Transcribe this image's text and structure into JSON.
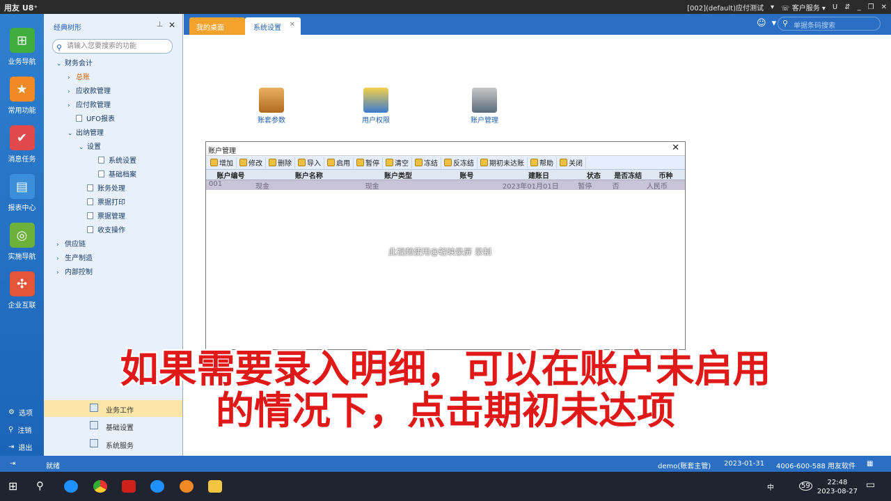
{
  "titlebar": {
    "app_name": "用友 U8⁺",
    "account": "[002](default)应付测试",
    "customer_service": "客户服务",
    "controls": [
      "U",
      "⇵",
      "_",
      "❐",
      "✕"
    ]
  },
  "nav": [
    {
      "label": "业务导航",
      "icon": "tree-icon",
      "color": "#3fae3f"
    },
    {
      "label": "常用功能",
      "icon": "star-icon",
      "color": "#f08a24"
    },
    {
      "label": "消息任务",
      "icon": "check-icon",
      "color": "#e04a4a"
    },
    {
      "label": "报表中心",
      "icon": "chart-icon",
      "color": "#3a8fd8"
    },
    {
      "label": "实施导航",
      "icon": "compass-icon",
      "color": "#6bb13a"
    },
    {
      "label": "企业互联",
      "icon": "link-icon",
      "color": "#e45438"
    }
  ],
  "bottom_nav": [
    {
      "label": "选项",
      "icon": "⚙"
    },
    {
      "label": "注销",
      "icon": "⚲"
    },
    {
      "label": "退出",
      "icon": "⇥"
    }
  ],
  "tree": {
    "title": "经典树形",
    "search_placeholder": "请输入您要搜索的功能",
    "nodes": [
      {
        "label": "财务会计",
        "arrow": "⌄",
        "indent": 0
      },
      {
        "label": "总账",
        "arrow": "›",
        "indent": 1,
        "active": true
      },
      {
        "label": "应收款管理",
        "arrow": "›",
        "indent": 1
      },
      {
        "label": "应付款管理",
        "arrow": "›",
        "indent": 1
      },
      {
        "label": "UFO报表",
        "arrow": "",
        "indent": 1,
        "doc": true
      },
      {
        "label": "出纳管理",
        "arrow": "⌄",
        "indent": 1
      },
      {
        "label": "设置",
        "arrow": "⌄",
        "indent": 2
      },
      {
        "label": "系统设置",
        "arrow": "",
        "indent": 3,
        "doc": true
      },
      {
        "label": "基础档案",
        "arrow": "",
        "indent": 3,
        "doc": true
      },
      {
        "label": "账务处理",
        "arrow": "",
        "indent": 2,
        "doc": true
      },
      {
        "label": "票据打印",
        "arrow": "",
        "indent": 2,
        "doc": true
      },
      {
        "label": "票据管理",
        "arrow": "",
        "indent": 2,
        "doc": true
      },
      {
        "label": "收支操作",
        "arrow": "",
        "indent": 2,
        "doc": true
      },
      {
        "label": "供应链",
        "arrow": "›",
        "indent": 0
      },
      {
        "label": "生产制造",
        "arrow": "›",
        "indent": 0
      },
      {
        "label": "内部控制",
        "arrow": "›",
        "indent": 0
      }
    ],
    "bottom_items": [
      "业务工作",
      "基础设置",
      "系统服务"
    ]
  },
  "tabs": {
    "desktop": "我的桌面",
    "settings": "系统设置",
    "search_placeholder": "单据条码搜索"
  },
  "shortcuts": [
    {
      "label": "账套参数"
    },
    {
      "label": "用户权限"
    },
    {
      "label": "账户管理"
    }
  ],
  "dialog": {
    "title": "账户管理",
    "toolbar": [
      "增加",
      "修改",
      "删除",
      "导入",
      "启用",
      "暂停",
      "清空",
      "冻结",
      "反冻结",
      "期初未达账",
      "帮助",
      "关闭"
    ],
    "columns": [
      "账户编号",
      "账户名称",
      "账户类型",
      "账号",
      "建账日",
      "状态",
      "是否冻结",
      "币种"
    ],
    "rows": [
      [
        "001",
        "现金",
        "现金",
        "",
        "2023年01月01日",
        "暂停",
        "否",
        "人民币"
      ]
    ]
  },
  "watermark": "此视频使用@轻映录屏 录制",
  "caption": {
    "line1": "如果需要录入明细，可以在账户未启用",
    "line2": "的情况下，点击期初未达项"
  },
  "status": {
    "ready": "就绪",
    "user": "demo(账套主管)",
    "date": "2023-01-31",
    "hotline": "4006-600-588 用友软件"
  },
  "taskbar": {
    "time": "22:48",
    "date": "2023-08-27",
    "lang": "中",
    "badge": "59"
  }
}
